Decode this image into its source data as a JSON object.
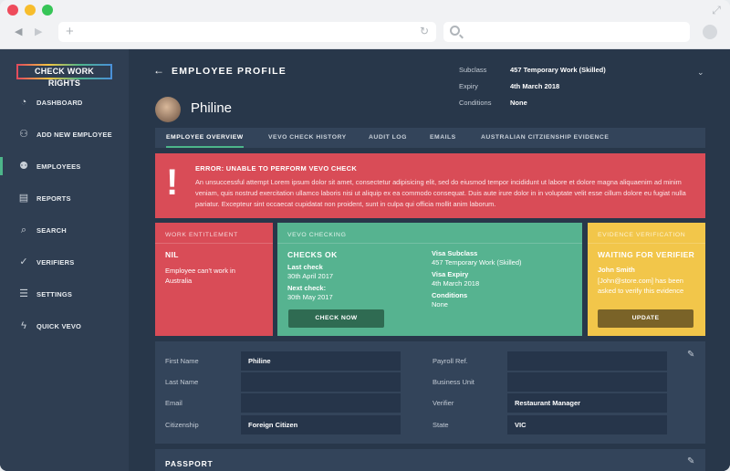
{
  "sidebar": {
    "logo": "CHECK WORK RIGHTS",
    "items": [
      {
        "label": "DASHBOARD",
        "icon": "dashboard-icon"
      },
      {
        "label": "ADD NEW EMPLOYEE",
        "icon": "add-user-icon"
      },
      {
        "label": "EMPLOYEES",
        "icon": "users-icon",
        "active": true
      },
      {
        "label": "REPORTS",
        "icon": "document-icon"
      },
      {
        "label": "SEARCH",
        "icon": "search-icon"
      },
      {
        "label": "VERIFIERS",
        "icon": "check-circle-icon"
      },
      {
        "label": "SETTINGS",
        "icon": "sliders-icon"
      },
      {
        "label": "QUICK VEVO",
        "icon": "lightning-icon"
      }
    ]
  },
  "header": {
    "title": "EMPLOYEE PROFILE",
    "employee_name": "Philine",
    "meta": [
      {
        "label": "Subclass",
        "value": "457 Temporary Work (Skilled)"
      },
      {
        "label": "Expiry",
        "value": "4th March 2018"
      },
      {
        "label": "Conditions",
        "value": "None"
      }
    ]
  },
  "tabs": [
    "EMPLOYEE OVERVIEW",
    "VEVO CHECK HISTORY",
    "AUDIT LOG",
    "EMAILS",
    "AUSTRALIAN CITZIENSHIP EVIDENCE"
  ],
  "error": {
    "title": "ERROR: UNABLE TO PERFORM VEVO CHECK",
    "body": "An unsuccessful attempt Lorem ipsum dolor sit amet, consectetur adipisicing elit, sed do eiusmod tempor incididunt ut labore et dolore magna aliquaenim ad minim veniam, quis nostrud exercitation ullamco laboris nisi ut aliquip ex ea commodo consequat. Duis aute irure dolor in in voluptate velit esse cillum dolore eu fugiat nulla pariatur. Excepteur sint occaecat cupidatat non proident, sunt in culpa qui officia mollit anim laborum."
  },
  "work_entitlement": {
    "heading": "WORK ENTITLEMENT",
    "status": "NIL",
    "message": "Employee can't work in Australia"
  },
  "vevo_checking": {
    "heading": "VEVO CHECKING",
    "status": "CHECKS OK",
    "last_check_label": "Last check",
    "last_check": "30th April 2017",
    "next_check_label": "Next check:",
    "next_check": "30th May 2017",
    "visa_subclass_label": "Visa Subclass",
    "visa_subclass": "457 Temporary Work (Skilled)",
    "visa_expiry_label": "Visa Expiry",
    "visa_expiry": "4th March 2018",
    "conditions_label": "Conditions",
    "conditions": "None",
    "button": "CHECK NOW"
  },
  "evidence_verification": {
    "heading": "EVIDENCE VERIFICATION",
    "status": "WAITING FOR VERIFIER",
    "verifier_name": "John Smith",
    "message": "[John@store.com] has been asked to verify this evidence",
    "button": "UPDATE"
  },
  "form": {
    "fields_left": [
      {
        "label": "First Name",
        "value": "Philine"
      },
      {
        "label": "Last Name",
        "value": ""
      },
      {
        "label": "Email",
        "value": ""
      },
      {
        "label": "Citizenship",
        "value": "Foreign Citizen"
      }
    ],
    "fields_right": [
      {
        "label": "Payroll Ref.",
        "value": ""
      },
      {
        "label": "Business Unit",
        "value": ""
      },
      {
        "label": "Verifier",
        "value": "Restaurant Manager"
      },
      {
        "label": "State",
        "value": "VIC"
      }
    ]
  },
  "passport": {
    "title": "PASSPORT"
  },
  "colors": {
    "sidebar_bg": "#2f3e52",
    "main_bg": "#28374a",
    "error_red": "#d94c57",
    "success_green": "#56b390",
    "warning_yellow": "#f2c64a",
    "accent_green": "#4db58a"
  }
}
